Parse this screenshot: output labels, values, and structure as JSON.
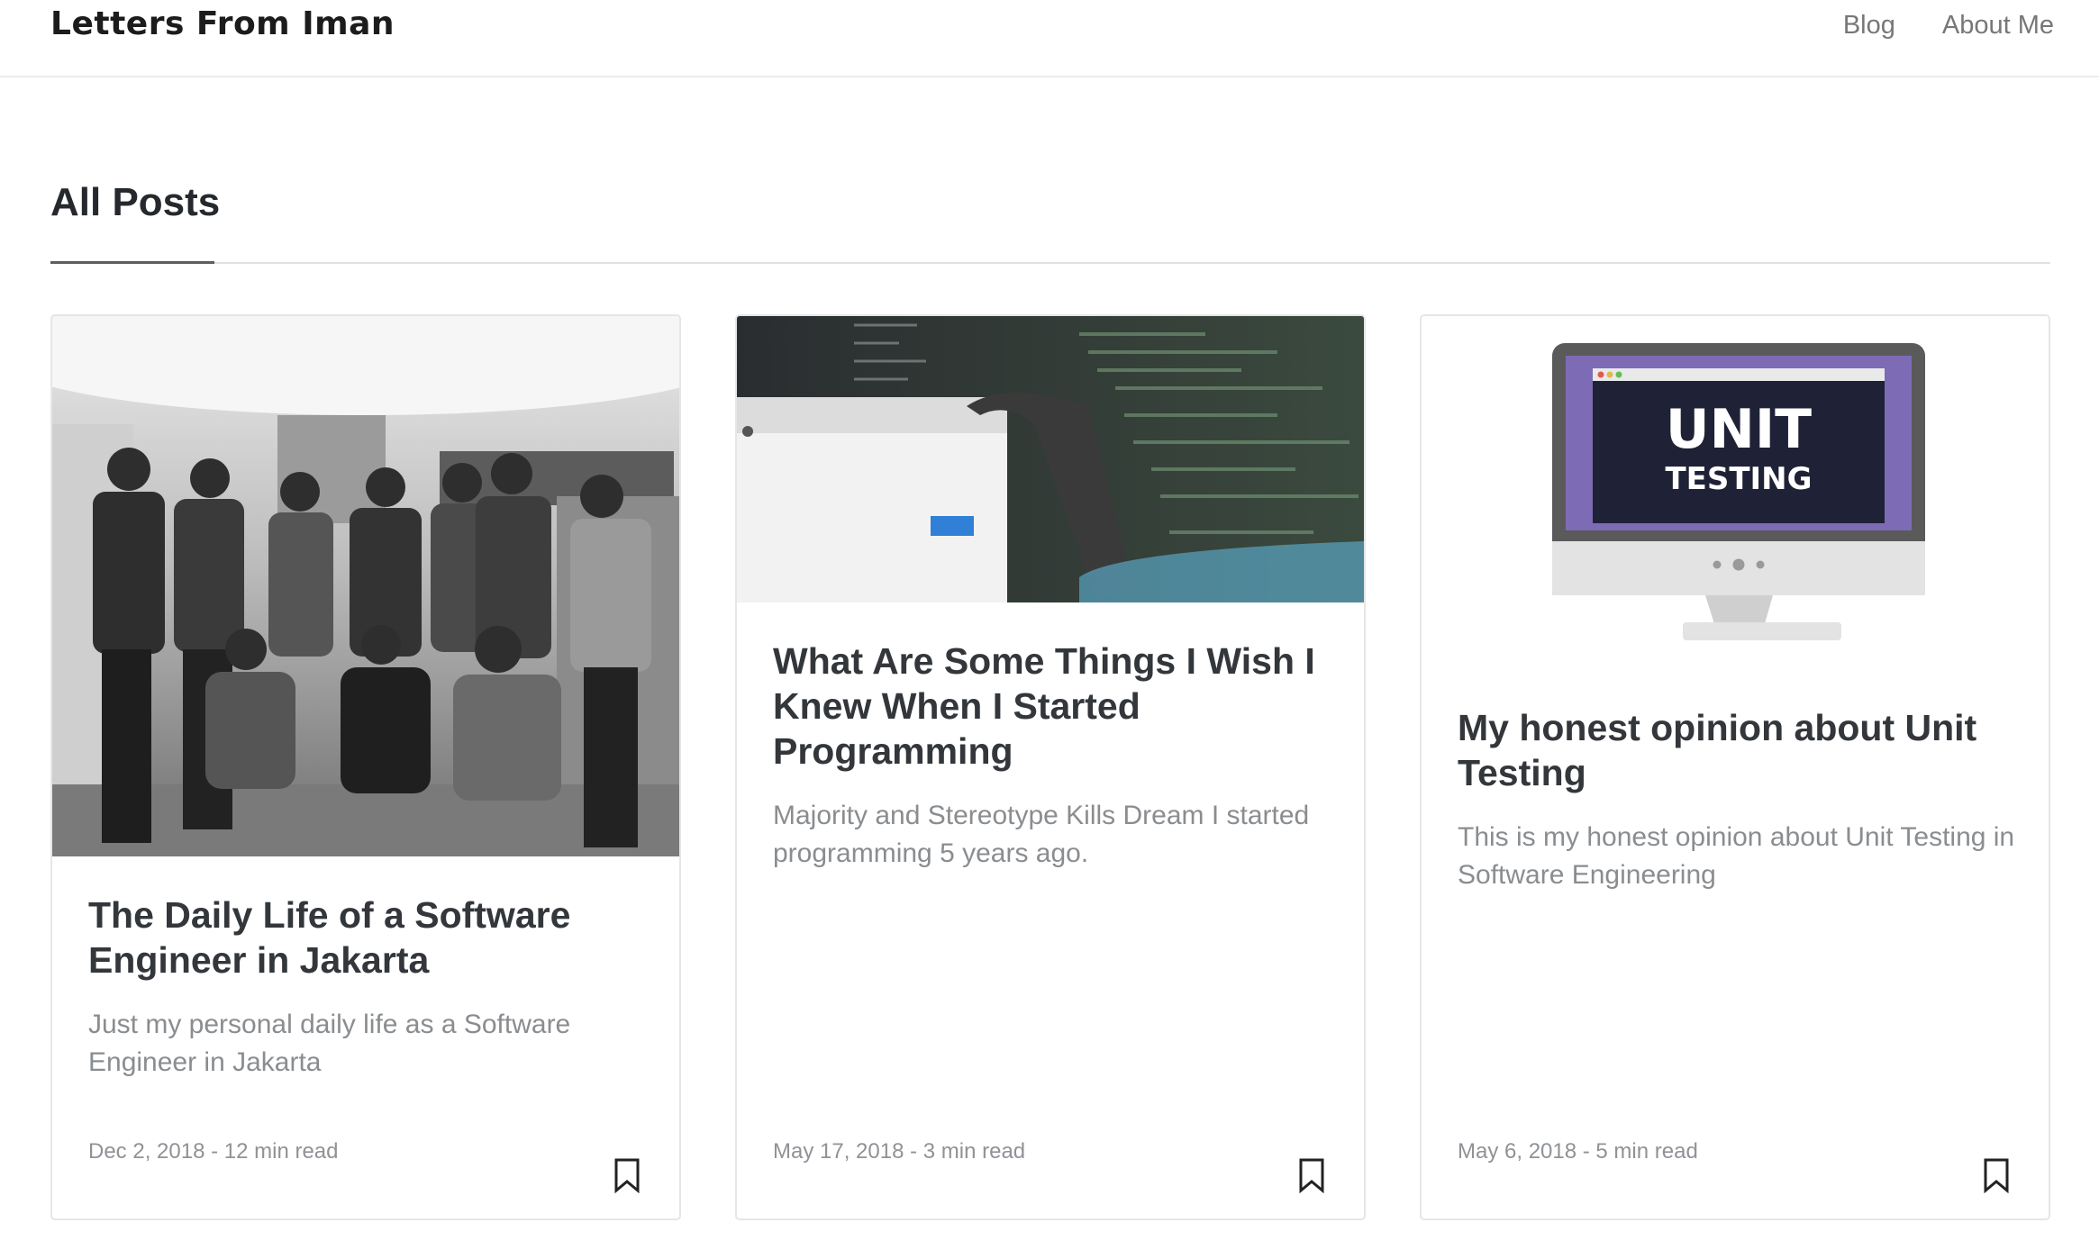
{
  "site": {
    "brand": "Letters From Iman",
    "nav": [
      "Blog",
      "About Me"
    ]
  },
  "section": {
    "title": "All Posts"
  },
  "screen_text": {
    "monitor_line1": "UNIT",
    "monitor_line2": "TESTING"
  },
  "posts": [
    {
      "title": "The Daily Life of a Software Engineer in Jakarta",
      "excerpt": "Just my personal daily life as a Software Engineer in Jakarta",
      "meta": "Dec 2, 2018 - 12 min read",
      "thumbnail": "group-photo"
    },
    {
      "title": "What Are Some Things I Wish I Knew When I Started Programming",
      "excerpt": "Majority and Stereotype Kills Dream I started programming 5 years ago.",
      "meta": "May 17, 2018 - 3 min read",
      "thumbnail": "laptop-code-photo"
    },
    {
      "title": "My honest opinion about Unit Testing",
      "excerpt": "This is my honest opinion about Unit Testing in Software Engineering",
      "meta": "May 6, 2018 - 5 min read",
      "thumbnail": "unit-testing-illustration"
    }
  ],
  "colors": {
    "heading": "#33373b",
    "muted": "#8a8d90",
    "border": "#e6e6e6",
    "monitor_purple": "#7e6bb5",
    "monitor_screen": "#1f2236"
  },
  "icons": [
    "bookmark-icon"
  ]
}
